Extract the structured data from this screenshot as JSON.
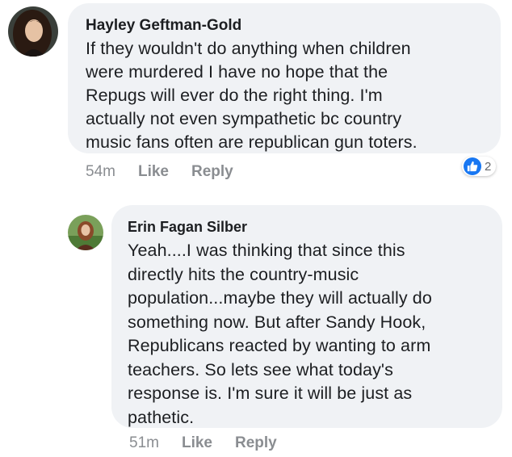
{
  "comments": [
    {
      "author": "Hayley Geftman-Gold",
      "text": "If they wouldn't do anything when children\nwere murdered I have no hope that the\nRepugs will ever do the right thing.  I'm\nactually not even sympathetic bc country\nmusic fans often are republican gun toters.",
      "time": "54m",
      "like_label": "Like",
      "reply_label": "Reply",
      "reaction_icon": "thumbs-up-icon",
      "reaction_count": "2",
      "avatar_icon": "profile-photo",
      "reaction_color": "#1877f2"
    },
    {
      "author": "Erin Fagan Silber",
      "text": "Yeah....I was thinking that since this\ndirectly hits the country-music\npopulation...maybe they will actually do\nsomething now.  But after Sandy Hook,\nRepublicans reacted by wanting to arm\nteachers.  So lets see what today's\nresponse is.  I'm sure it will be just as\npathetic.",
      "time": "51m",
      "like_label": "Like",
      "reply_label": "Reply",
      "avatar_icon": "profile-photo"
    }
  ],
  "colors": {
    "bubble": "#f0f2f5",
    "meta": "#8a8d91",
    "text": "#1c1e21"
  }
}
